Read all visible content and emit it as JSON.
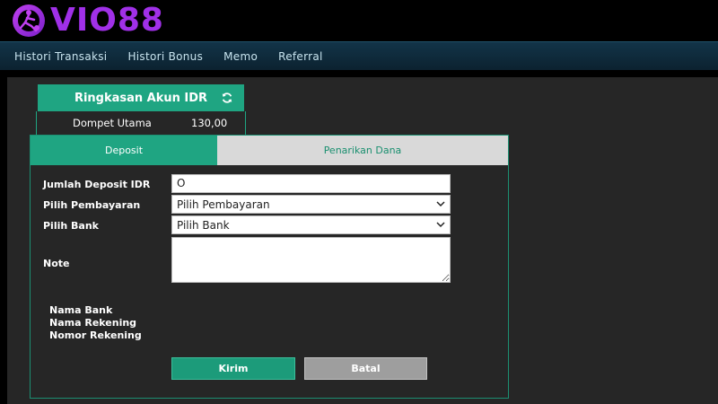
{
  "brand": {
    "logo_text": "VIO88",
    "logo_icon": "soccer-player-ball-icon",
    "color": "#a030e8"
  },
  "nav": {
    "items": [
      {
        "label": "Histori Transaksi"
      },
      {
        "label": "Histori Bonus"
      },
      {
        "label": "Memo"
      },
      {
        "label": "Referral"
      }
    ]
  },
  "summary": {
    "title": "Ringkasan Akun IDR",
    "refresh_icon": "refresh-icon",
    "wallet_label": "Dompet Utama",
    "wallet_value": "130,00"
  },
  "tabs": {
    "deposit": "Deposit",
    "withdraw": "Penarikan Dana",
    "active": "Deposit"
  },
  "form": {
    "amount_label": "Jumlah Deposit IDR",
    "amount_value": "O",
    "payment_label": "Pilih Pembayaran",
    "payment_value": "Pilih Pembayaran",
    "bank_label": "Pilih Bank",
    "bank_value": "Pilih Bank",
    "note_label": "Note",
    "note_value": "",
    "bank_name_label": "Nama Bank",
    "account_name_label": "Nama Rekening",
    "account_number_label": "Nomor Rekening",
    "submit_label": "Kirim",
    "cancel_label": "Batal"
  },
  "colors": {
    "accent": "#1fa582",
    "tab_inactive": "#d9d9d9",
    "panel": "#262626",
    "nav": "#123448"
  }
}
